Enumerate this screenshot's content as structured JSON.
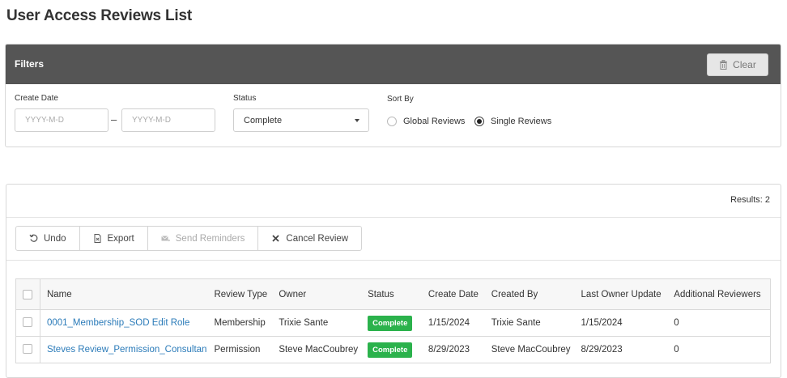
{
  "page": {
    "title": "User Access Reviews List"
  },
  "filters": {
    "title": "Filters",
    "clear_label": "Clear",
    "create_date_label": "Create Date",
    "date_from_placeholder": "YYYY-M-D",
    "date_separator": "–",
    "date_to_placeholder": "YYYY-M-D",
    "status_label": "Status",
    "status_value": "Complete",
    "sort_by_label": "Sort By",
    "sort_options": [
      {
        "label": "Global Reviews",
        "selected": false
      },
      {
        "label": "Single Reviews",
        "selected": true
      }
    ]
  },
  "results": {
    "count_text": "Results: 2",
    "toolbar": {
      "undo_label": "Undo",
      "export_label": "Export",
      "send_reminders_label": "Send Reminders",
      "cancel_review_label": "Cancel Review"
    },
    "columns": [
      "Name",
      "Review Type",
      "Owner",
      "Status",
      "Create Date",
      "Created By",
      "Last Owner Update",
      "Additional Reviewers"
    ],
    "rows": [
      {
        "name": "0001_Membership_SOD Edit Role",
        "review_type": "Membership",
        "owner": "Trixie Sante",
        "status": "Complete",
        "create_date": "1/15/2024",
        "created_by": "Trixie Sante",
        "last_owner_update": "1/15/2024",
        "additional_reviewers": "0"
      },
      {
        "name": "Steves Review_Permission_Consultant",
        "review_type": "Permission",
        "owner": "Steve MacCoubrey",
        "status": "Complete",
        "create_date": "8/29/2023",
        "created_by": "Steve MacCoubrey",
        "last_owner_update": "8/29/2023",
        "additional_reviewers": "0"
      }
    ]
  },
  "colors": {
    "header_bg": "#555555",
    "link": "#2b7bb9",
    "status_complete": "#2bb24c"
  }
}
